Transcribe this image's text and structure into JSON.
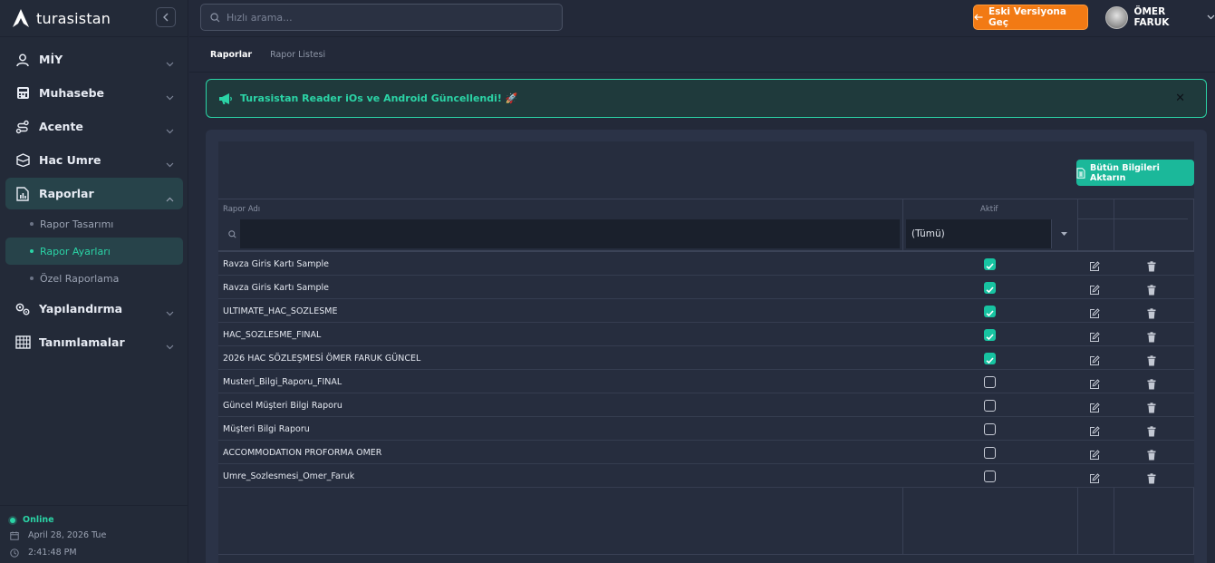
{
  "app": {
    "logo_text": "turasistan"
  },
  "search": {
    "placeholder": "Hızlı arama..."
  },
  "topbar": {
    "old_version_label": "Eski Versiyona Geç",
    "user_name": "ÖMER FARUK"
  },
  "sidebar": {
    "items": [
      {
        "label": "MİY",
        "icon": "user-icon"
      },
      {
        "label": "Muhasebe",
        "icon": "calculator-icon"
      },
      {
        "label": "Acente",
        "icon": "route-icon"
      },
      {
        "label": "Hac Umre",
        "icon": "kaaba-icon"
      },
      {
        "label": "Raporlar",
        "icon": "report-icon",
        "expanded": true
      },
      {
        "label": "Yapılandırma",
        "icon": "settings-icon"
      },
      {
        "label": "Tanımlamalar",
        "icon": "grid-icon"
      }
    ],
    "sub_items": [
      {
        "label": "Rapor Tasarımı",
        "active": false
      },
      {
        "label": "Rapor Ayarları",
        "active": true
      },
      {
        "label": "Özel Raporlama",
        "active": false
      }
    ],
    "footer": {
      "status": "Online",
      "date": "April 28, 2026 Tue",
      "time": "2:41:48 PM"
    }
  },
  "breadcrumb": {
    "root": "Raporlar",
    "current": "Rapor Listesi"
  },
  "alert": {
    "message": "Turasistan Reader iOs ve Android Güncellendi! 🚀"
  },
  "grid": {
    "export_label": "Bütün Bilgileri Aktarın",
    "columns": {
      "name": "Rapor Adı",
      "active": "Aktif"
    },
    "filter": {
      "active_value": "(Tümü)"
    },
    "rows": [
      {
        "name": "Ravza Giris Kartı Sample",
        "active": true
      },
      {
        "name": "Ravza Giris Kartı Sample",
        "active": true
      },
      {
        "name": "ULTIMATE_HAC_SOZLESME",
        "active": true
      },
      {
        "name": "HAC_SOZLESME_FINAL",
        "active": true
      },
      {
        "name": "2026 HAC SÖZLEŞMESİ ÖMER FARUK GÜNCEL",
        "active": true
      },
      {
        "name": "Musteri_Bilgi_Raporu_FINAL",
        "active": false
      },
      {
        "name": "Güncel Müşteri Bilgi Raporu",
        "active": false
      },
      {
        "name": "Müşteri Bilgi Raporu",
        "active": false
      },
      {
        "name": "ACCOMMODATION PROFORMA OMER",
        "active": false
      },
      {
        "name": "Umre_Sozlesmesi_Omer_Faruk",
        "active": false
      }
    ]
  },
  "colors": {
    "accent": "#2bd4a6",
    "orange": "#f27a14",
    "teal_button": "#1bb89a"
  }
}
